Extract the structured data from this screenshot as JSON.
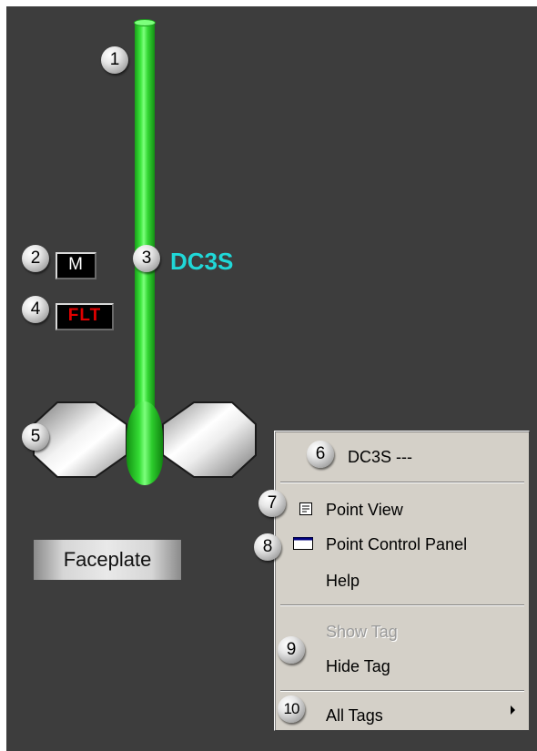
{
  "graphic": {
    "tag_name": "DC3S",
    "mode_indicator": "M",
    "fault_indicator": "FLT",
    "faceplate_button": "Faceplate",
    "shaft_color": "#3ee83e",
    "tag_color": "#20d8d8",
    "fault_color": "#e00000",
    "background_color": "#3d3d3d"
  },
  "callouts": [
    "1",
    "2",
    "3",
    "4",
    "5",
    "6",
    "7",
    "8",
    "9",
    "10"
  ],
  "context_menu": {
    "header": "DC3S ---",
    "items": [
      {
        "label": "Point View",
        "icon": "point-view-icon",
        "enabled": true
      },
      {
        "label": "Point Control Panel",
        "icon": "control-panel-icon",
        "enabled": true
      },
      {
        "label": "Help",
        "enabled": true
      },
      {
        "label": "Show Tag",
        "enabled": false
      },
      {
        "label": "Hide Tag",
        "enabled": true
      },
      {
        "label": "All Tags",
        "icon": "submenu-arrow-icon",
        "enabled": true
      }
    ]
  }
}
